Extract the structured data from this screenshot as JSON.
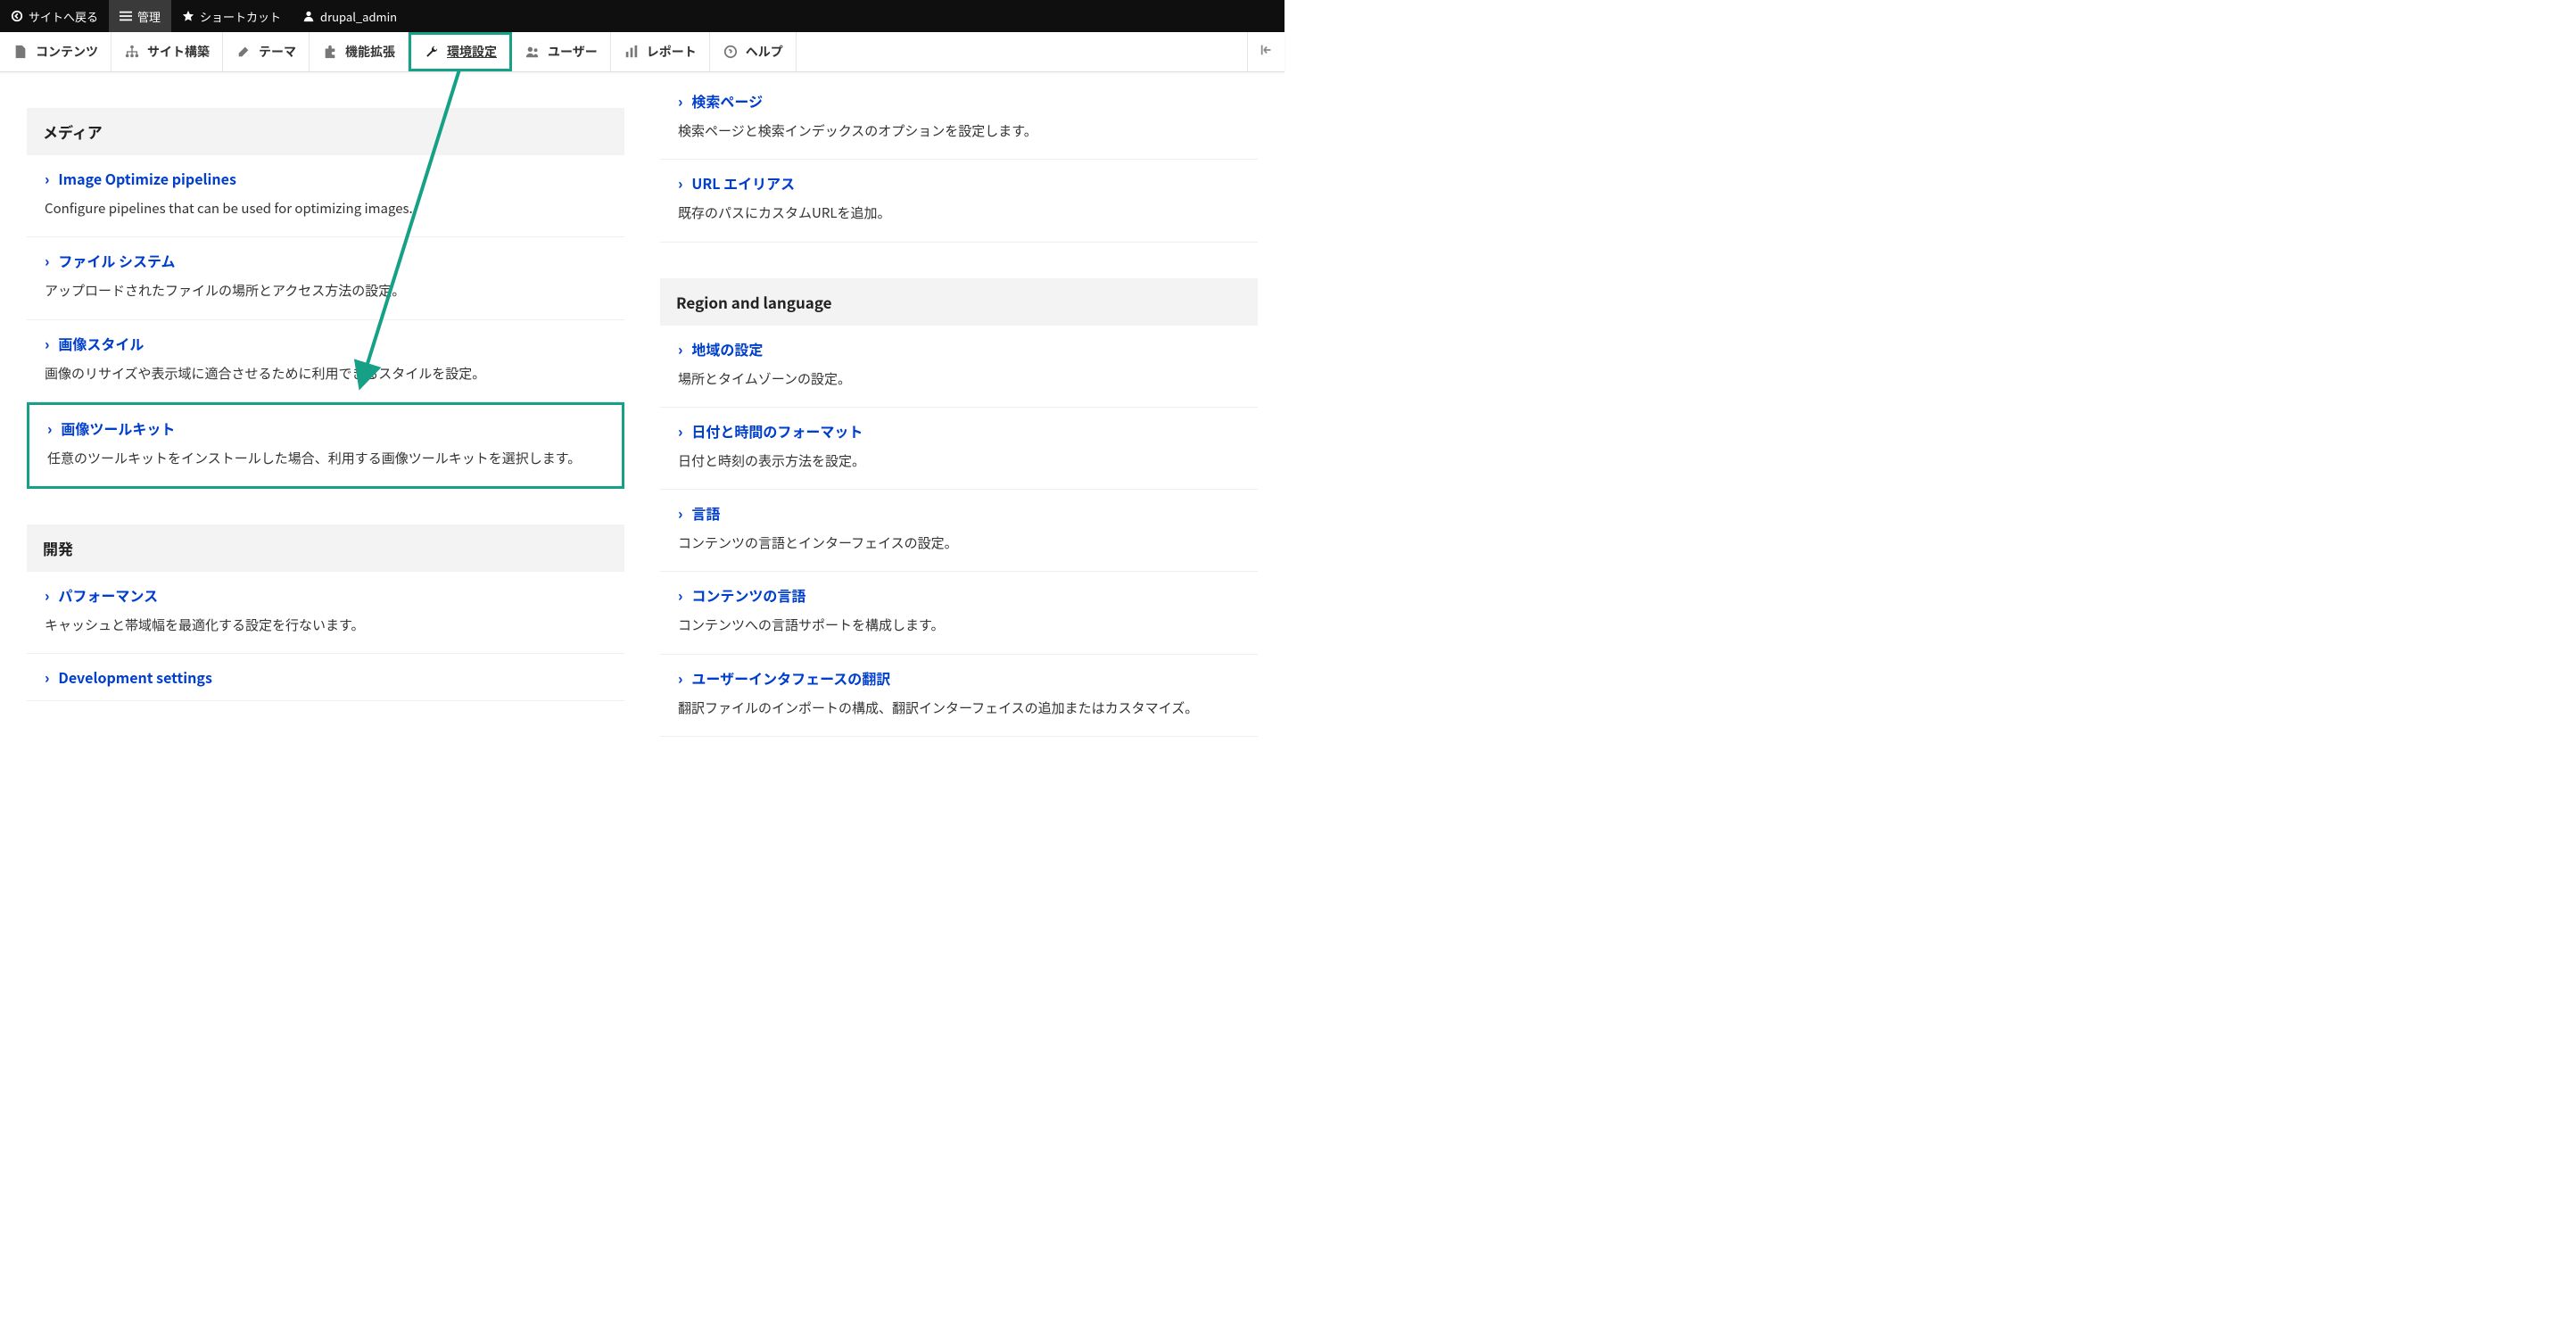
{
  "topbar": {
    "back": "サイトへ戻る",
    "manage": "管理",
    "shortcuts": "ショートカット",
    "user": "drupal_admin"
  },
  "toolbar": {
    "content": "コンテンツ",
    "structure": "サイト構築",
    "appearance": "テーマ",
    "extend": "機能拡張",
    "configuration": "環境設定",
    "people": "ユーザー",
    "reports": "レポート",
    "help": "ヘルプ"
  },
  "left": {
    "media_header": "メディア",
    "media": [
      {
        "title": "Image Optimize pipelines",
        "desc": "Configure pipelines that can be used for optimizing images."
      },
      {
        "title": "ファイル システム",
        "desc": "アップロードされたファイルの場所とアクセス方法の設定。"
      },
      {
        "title": "画像スタイル",
        "desc": "画像のリサイズや表示域に適合させるために利用できるスタイルを設定。"
      },
      {
        "title": "画像ツールキット",
        "desc": "任意のツールキットをインストールした場合、利用する画像ツールキットを選択します。"
      }
    ],
    "dev_header": "開発",
    "dev": [
      {
        "title": "パフォーマンス",
        "desc": "キャッシュと帯域幅を最適化する設定を行ないます。"
      },
      {
        "title": "Development settings",
        "desc": ""
      }
    ]
  },
  "right": {
    "prelist": [
      {
        "title": "検索ページ",
        "desc": "検索ページと検索インデックスのオプションを設定します。"
      },
      {
        "title": "URL エイリアス",
        "desc": "既存のパスにカスタムURLを追加。"
      }
    ],
    "region_header": "Region and language",
    "region": [
      {
        "title": "地域の設定",
        "desc": "場所とタイムゾーンの設定。"
      },
      {
        "title": "日付と時間のフォーマット",
        "desc": "日付と時刻の表示方法を設定。"
      },
      {
        "title": "言語",
        "desc": "コンテンツの言語とインターフェイスの設定。"
      },
      {
        "title": "コンテンツの言語",
        "desc": "コンテンツへの言語サポートを構成します。"
      },
      {
        "title": "ユーザーインタフェースの翻訳",
        "desc": "翻訳ファイルのインポートの構成、翻訳インターフェイスの追加またはカスタマイズ。"
      }
    ]
  }
}
